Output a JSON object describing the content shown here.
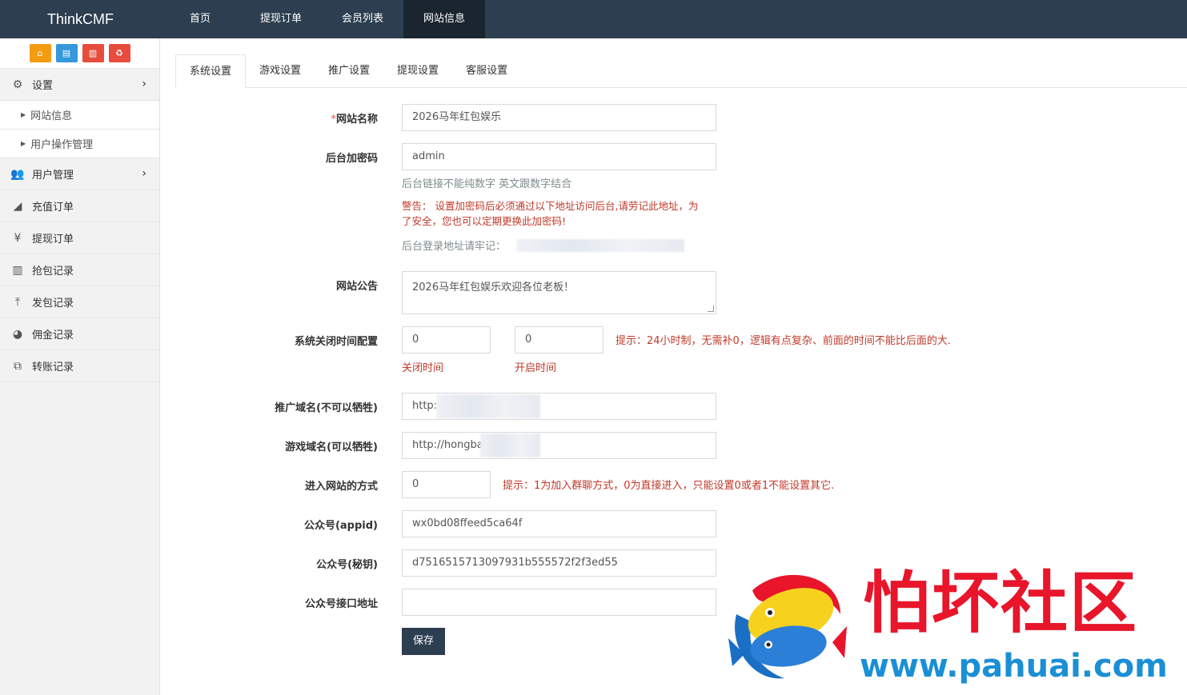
{
  "app": {
    "brand": "ThinkCMF"
  },
  "topnav": [
    "首页",
    "提现订单",
    "会员列表",
    "网站信息"
  ],
  "topnav_active": "网站信息",
  "shortcuts": [
    {
      "icon": "home-icon",
      "color": "#f39c12",
      "glyph": "⌂"
    },
    {
      "icon": "file-icon",
      "color": "#3498db",
      "glyph": "▤"
    },
    {
      "icon": "trash-icon",
      "color": "#e74c3c",
      "glyph": "🗑"
    },
    {
      "icon": "recycle-icon",
      "color": "#e74c3c",
      "glyph": "♻"
    }
  ],
  "sidebar": {
    "settings": "设置",
    "settings_sub": [
      "网站信息",
      "用户操作管理"
    ],
    "user_mgmt": "用户管理",
    "items": [
      "充值订单",
      "提现订单",
      "抢包记录",
      "发包记录",
      "佣金记录",
      "转账记录"
    ]
  },
  "tabs": [
    "系统设置",
    "游戏设置",
    "推广设置",
    "提现设置",
    "客服设置"
  ],
  "form": {
    "site_name_label": "网站名称",
    "site_name_required": "*",
    "site_name": "2026马年红包娱乐",
    "admin_key_label": "后台加密码",
    "admin_key": "admin",
    "admin_key_help": "后台链接不能纯数字 英文跟数字结合",
    "admin_key_warning": "警告： 设置加密码后必须通过以下地址访问后台,请劳记此地址，为了安全，您也可以定期更换此加密码!",
    "admin_url_label": "后台登录地址请牢记：",
    "notice_label": "网站公告",
    "notice": "2026马年红包娱乐欢迎各位老板！",
    "close_time_label": "系统关闭时间配置",
    "close_time": "0",
    "open_time": "0",
    "close_time_caption": "关闭时间",
    "open_time_caption": "开启时间",
    "time_hint": "提示：24小时制，无需补0，逻辑有点复杂、前面的时间不能比后面的大.",
    "promo_domain_label": "推广域名(不可以牺牲)",
    "promo_domain": "http:",
    "game_domain_label": "游戏域名(可以牺牲)",
    "game_domain": "http://hongbao",
    "enter_mode_label": "进入网站的方式",
    "enter_mode": "0",
    "enter_mode_hint": "提示：1为加入群聊方式，0为直接进入，只能设置0或者1不能设置其它.",
    "appid_label": "公众号(appid)",
    "appid": "wx0bd08ffeed5ca64f",
    "secret_label": "公众号(秘钥)",
    "secret": "d7516515713097931b555572f2f3ed55",
    "api_url_label": "公众号接口地址",
    "api_url": "",
    "save": "保存"
  },
  "watermark": {
    "title": "怕坏社区",
    "url": "www.pahuai.com"
  }
}
